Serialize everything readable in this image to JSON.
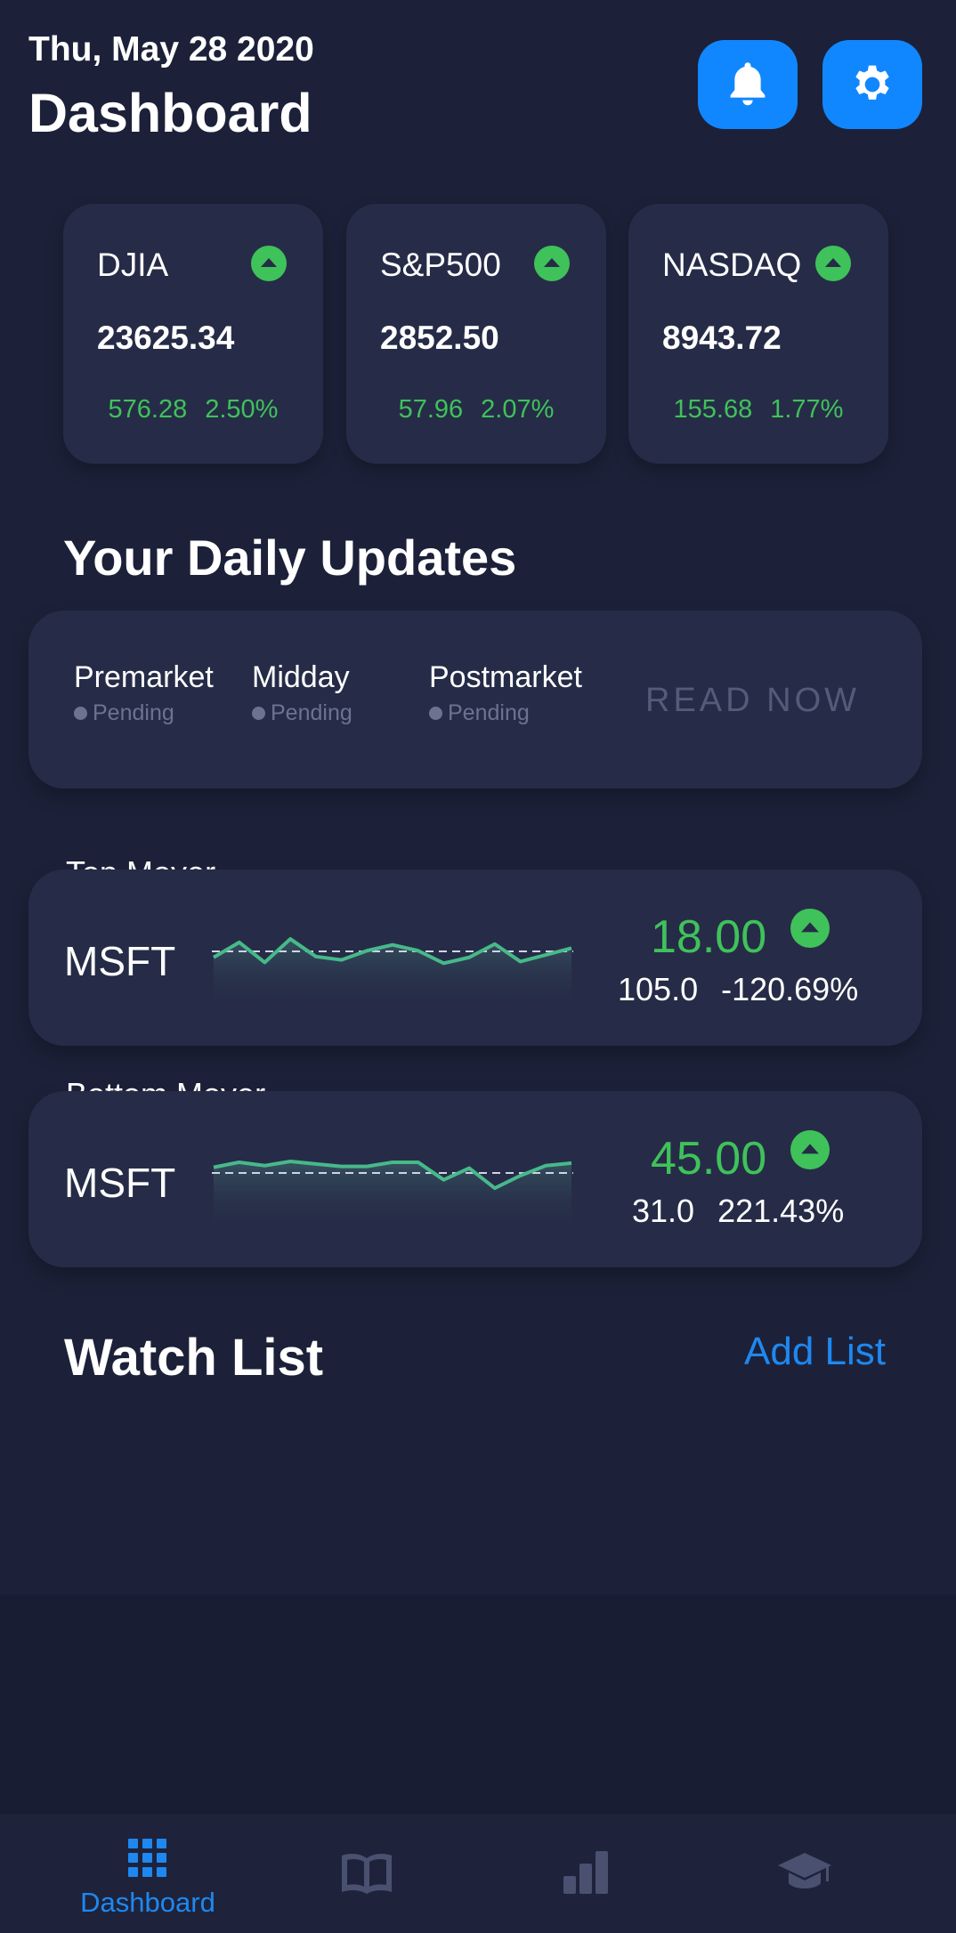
{
  "header": {
    "date": "Thu, May 28 2020",
    "title": "Dashboard",
    "bell_icon": "bell-icon",
    "settings_icon": "gear-icon"
  },
  "indices": [
    {
      "name": "DJIA",
      "value": "23625.34",
      "change": "576.28",
      "percent": "2.50%",
      "direction": "up"
    },
    {
      "name": "S&P500",
      "value": "2852.50",
      "change": "57.96",
      "percent": "2.07%",
      "direction": "up"
    },
    {
      "name": "NASDAQ",
      "value": "8943.72",
      "change": "155.68",
      "percent": "1.77%",
      "direction": "up"
    }
  ],
  "daily_updates": {
    "title": "Your Daily Updates",
    "items": [
      {
        "label": "Premarket",
        "status": "Pending"
      },
      {
        "label": "Midday",
        "status": "Pending"
      },
      {
        "label": "Postmarket",
        "status": "Pending"
      }
    ],
    "action": "READ NOW"
  },
  "top_mover": {
    "label": "Top Mover",
    "ticker": "MSFT",
    "price": "18.00",
    "previous": "105.0",
    "percent": "-120.69%",
    "direction": "up",
    "trend": [
      46,
      64,
      40,
      68,
      47,
      43,
      54,
      61,
      54,
      39,
      46,
      62,
      41,
      49,
      57
    ]
  },
  "bottom_mover": {
    "label": "Bottom Mover",
    "ticker": "MSFT",
    "price": "45.00",
    "previous": "31.0",
    "percent": "221.43%",
    "direction": "up",
    "trend": [
      60,
      66,
      62,
      67,
      64,
      61,
      61,
      66,
      66,
      45,
      59,
      35,
      50,
      62,
      65
    ]
  },
  "watch_list": {
    "title": "Watch List",
    "add_label": "Add List"
  },
  "colors": {
    "background": "#1c2139",
    "card": "#262c47",
    "accent": "#1187ff",
    "positive": "#3fc25a",
    "sparkline": "#47b98a"
  },
  "bottom_nav": [
    {
      "icon": "grid-icon",
      "label": "Dashboard",
      "active": true
    },
    {
      "icon": "book-icon",
      "label": "",
      "active": false
    },
    {
      "icon": "bar-chart-icon",
      "label": "",
      "active": false
    },
    {
      "icon": "graduation-cap-icon",
      "label": "",
      "active": false
    }
  ]
}
